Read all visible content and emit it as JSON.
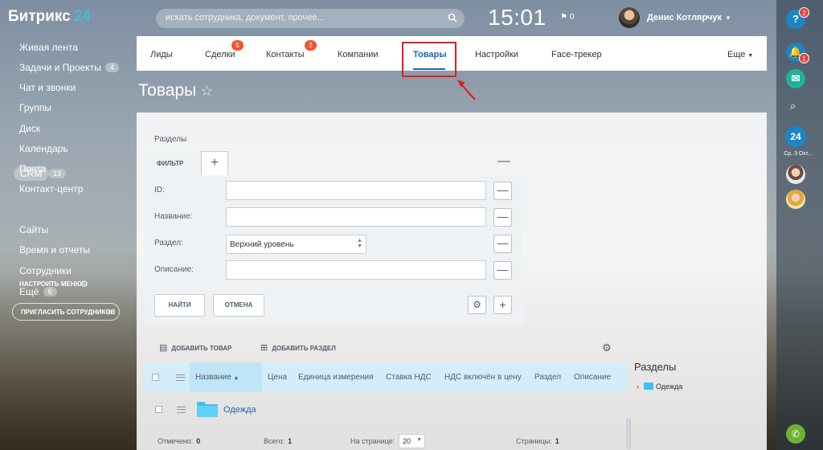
{
  "header": {
    "logo_text": "Битрикс",
    "logo_num": "24",
    "search_placeholder": "искать сотрудника, документ, прочее...",
    "clock": "15:01",
    "flag_count": "0",
    "user_name": "Денис Котлярчук"
  },
  "sidebar": {
    "items": [
      {
        "label": "Живая лента"
      },
      {
        "label": "Задачи и Проекты",
        "count": "4"
      },
      {
        "label": "Чат и звонки"
      },
      {
        "label": "Группы"
      },
      {
        "label": "Диск"
      },
      {
        "label": "Календарь"
      },
      {
        "label": "Почта"
      },
      {
        "label": "Контакт-центр"
      },
      {
        "label": "CRM",
        "count": "13"
      },
      {
        "label": "Сайты"
      },
      {
        "label": "Время и отчеты"
      },
      {
        "label": "Сотрудники"
      },
      {
        "label": "Ещё",
        "count": "6"
      }
    ],
    "configure_label": "НАСТРОИТЬ МЕНЮ",
    "invite_label": "ПРИГЛАСИТЬ СОТРУДНИКОВ"
  },
  "rightpanel": {
    "help_badge": "2",
    "notif_badge": "1",
    "date_label": "Ср, 3 Окт..."
  },
  "tabs": [
    {
      "label": "Лиды"
    },
    {
      "label": "Сделки",
      "badge": "5"
    },
    {
      "label": "Контакты",
      "badge": "2"
    },
    {
      "label": "Компании"
    },
    {
      "label": "Товары",
      "active": true
    },
    {
      "label": "Настройки"
    },
    {
      "label": "Face-трекер"
    },
    {
      "label": "Еще"
    }
  ],
  "page": {
    "title": "Товары"
  },
  "filter": {
    "section_label": "Разделы",
    "tab_label": "ФИЛЬТР",
    "fields": [
      {
        "label": "ID:",
        "value": ""
      },
      {
        "label": "Название:",
        "value": ""
      },
      {
        "label": "Раздел:",
        "value": "Верхний уровень"
      },
      {
        "label": "Описание:",
        "value": ""
      }
    ],
    "find_button": "НАЙТИ",
    "cancel_button": "ОТМЕНА"
  },
  "actions": {
    "add_product": "ДОБАВИТЬ ТОВАР",
    "add_section": "ДОБАВИТЬ РАЗДЕЛ"
  },
  "grid": {
    "columns": [
      "Название",
      "Цена",
      "Единица измерения",
      "Ставка НДС",
      "НДС включён в цену",
      "Раздел",
      "Описание"
    ],
    "rows": [
      {
        "name": "Одежда"
      }
    ],
    "footer": {
      "selected_label": "Отмечено:",
      "selected_value": "0",
      "total_label": "Всего:",
      "total_value": "1",
      "per_page_label": "На странице:",
      "per_page_value": "20",
      "pages_label": "Страницы:",
      "pages_value": "1"
    }
  },
  "sections_panel": {
    "title": "Разделы",
    "items": [
      "Одежда"
    ]
  },
  "colors": {
    "accent": "#2067b0",
    "badge": "#f0562e",
    "highlight": "#e02020"
  }
}
